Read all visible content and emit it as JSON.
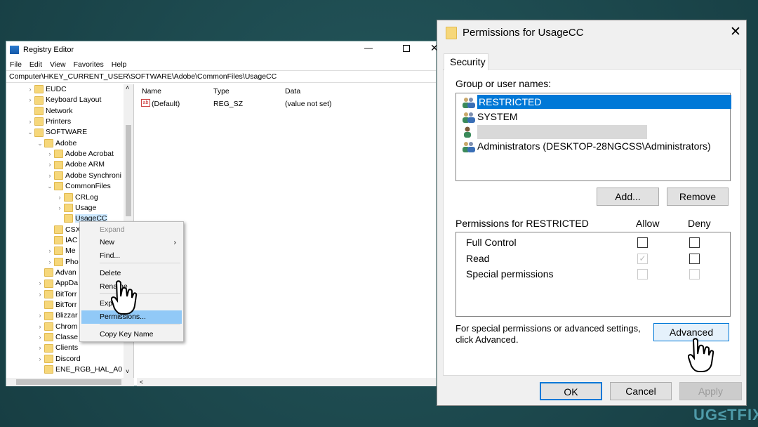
{
  "registry": {
    "title": "Registry Editor",
    "window_controls": [
      "minimize",
      "maximize",
      "close"
    ],
    "menu": [
      "File",
      "Edit",
      "View",
      "Favorites",
      "Help"
    ],
    "address": "Computer\\HKEY_CURRENT_USER\\SOFTWARE\\Adobe\\CommonFiles\\UsageCC",
    "tree": [
      {
        "label": "EUDC",
        "level": 1,
        "state": "collapsed"
      },
      {
        "label": "Keyboard Layout",
        "level": 1,
        "state": "collapsed"
      },
      {
        "label": "Network",
        "level": 1,
        "state": "leaf"
      },
      {
        "label": "Printers",
        "level": 1,
        "state": "collapsed"
      },
      {
        "label": "SOFTWARE",
        "level": 1,
        "state": "expanded"
      },
      {
        "label": "Adobe",
        "level": 2,
        "state": "expanded"
      },
      {
        "label": "Adobe Acrobat",
        "level": 3,
        "state": "collapsed"
      },
      {
        "label": "Adobe ARM",
        "level": 3,
        "state": "collapsed"
      },
      {
        "label": "Adobe Synchroni",
        "level": 3,
        "state": "collapsed"
      },
      {
        "label": "CommonFiles",
        "level": 3,
        "state": "expanded"
      },
      {
        "label": "CRLog",
        "level": 4,
        "state": "collapsed"
      },
      {
        "label": "Usage",
        "level": 4,
        "state": "collapsed"
      },
      {
        "label": "UsageCC",
        "level": 4,
        "state": "leaf",
        "selected": true
      },
      {
        "label": "CSX",
        "level": 3,
        "state": "leaf"
      },
      {
        "label": "IAC",
        "level": 3,
        "state": "leaf"
      },
      {
        "label": "Me",
        "level": 3,
        "state": "collapsed"
      },
      {
        "label": "Pho",
        "level": 3,
        "state": "collapsed"
      },
      {
        "label": "Advan",
        "level": 2,
        "state": "leaf"
      },
      {
        "label": "AppDa",
        "level": 2,
        "state": "collapsed"
      },
      {
        "label": "BitTorr",
        "level": 2,
        "state": "collapsed"
      },
      {
        "label": "BitTorr",
        "level": 2,
        "state": "leaf"
      },
      {
        "label": "Blizzar",
        "level": 2,
        "state": "collapsed"
      },
      {
        "label": "Chrom",
        "level": 2,
        "state": "collapsed"
      },
      {
        "label": "Classe",
        "level": 2,
        "state": "collapsed"
      },
      {
        "label": "Clients",
        "level": 2,
        "state": "collapsed"
      },
      {
        "label": "Discord",
        "level": 2,
        "state": "collapsed"
      },
      {
        "label": "ENE_RGB_HAL_A0",
        "level": 2,
        "state": "leaf"
      }
    ],
    "columns": [
      "Name",
      "Type",
      "Data"
    ],
    "values": [
      {
        "name": "(Default)",
        "type": "REG_SZ",
        "data": "(value not set)",
        "icon": "string-value-icon"
      }
    ],
    "context_menu": [
      {
        "label": "Expand",
        "disabled": true
      },
      {
        "label": "New",
        "submenu": true
      },
      {
        "label": "Find..."
      },
      {
        "label": "Delete"
      },
      {
        "label": "Rename"
      },
      {
        "label": "Export"
      },
      {
        "label": "Permissions...",
        "highlighted": true
      },
      {
        "label": "Copy Key Name"
      }
    ]
  },
  "dialog": {
    "title": "Permissions for UsageCC",
    "tab": "Security",
    "group_label": "Group or user names:",
    "users": [
      {
        "name": "RESTRICTED",
        "selected": true,
        "icon": "group-icon"
      },
      {
        "name": "SYSTEM",
        "icon": "group-icon"
      },
      {
        "name": "",
        "redacted": true,
        "icon": "user-icon"
      },
      {
        "name": "Administrators (DESKTOP-28NGCSS\\Administrators)",
        "icon": "group-icon"
      }
    ],
    "add_label": "Add...",
    "remove_label": "Remove",
    "perm_label": "Permissions for RESTRICTED",
    "allow_label": "Allow",
    "deny_label": "Deny",
    "permissions": [
      {
        "name": "Full Control",
        "allow": "unchecked",
        "deny": "unchecked"
      },
      {
        "name": "Read",
        "allow": "checked-disabled",
        "deny": "unchecked"
      },
      {
        "name": "Special permissions",
        "allow": "disabled",
        "deny": "disabled"
      }
    ],
    "advanced_text_1": "For special permissions or advanced settings,",
    "advanced_text_2": "click Advanced.",
    "advanced_label": "Advanced",
    "ok_label": "OK",
    "cancel_label": "Cancel",
    "apply_label": "Apply"
  },
  "watermark": "UG≤TFIX",
  "colors": {
    "selection": "#0078d7",
    "background": "#1c4a4f",
    "menu_highlight": "#91c9f7"
  }
}
